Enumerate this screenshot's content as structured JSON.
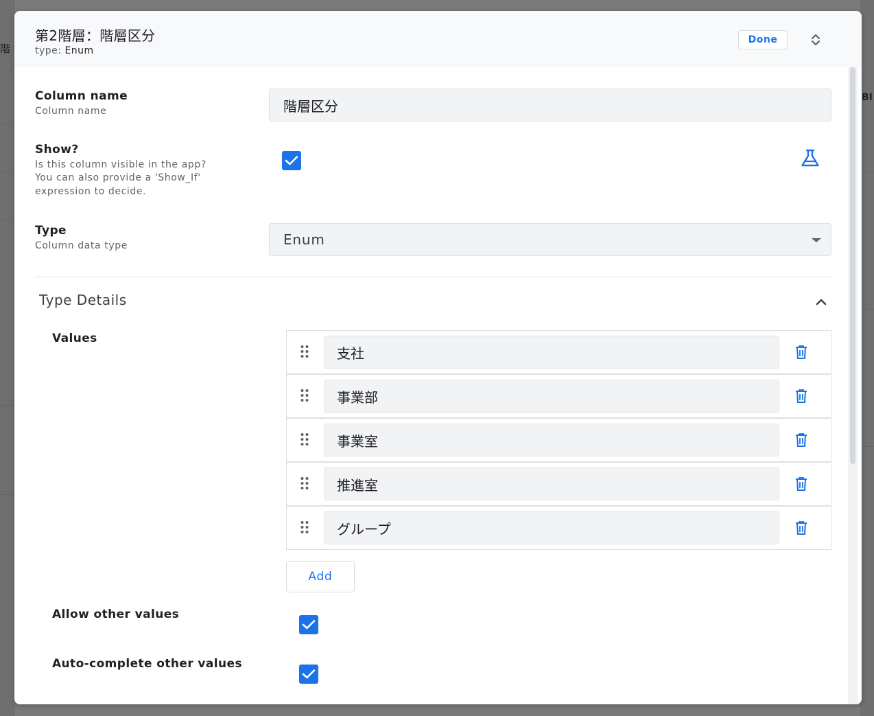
{
  "background": {
    "left_glyph": "階",
    "right_glyph": "BI"
  },
  "dialog": {
    "title": "第2階層：階層区分",
    "subtitle_label": "type: ",
    "subtitle_value": "Enum",
    "done_label": "Done",
    "expand_icon": "unfold-icon"
  },
  "column_name": {
    "title": "Column name",
    "description": "Column name",
    "value": "階層区分"
  },
  "show": {
    "title": "Show?",
    "description_lines": [
      "Is this column visible in the app?",
      "You can also provide a 'Show_If'",
      "expression to decide."
    ],
    "checked": true,
    "expression_icon": "flask-icon"
  },
  "type": {
    "title": "Type",
    "description": "Column data type",
    "value": "Enum"
  },
  "type_details": {
    "title": "Type Details",
    "values_label": "Values",
    "values": [
      "支社",
      "事業部",
      "事業室",
      "推進室",
      "グループ"
    ],
    "add_label": "Add",
    "allow_other": {
      "label": "Allow other values",
      "checked": true
    },
    "auto_complete": {
      "label": "Auto-complete other values",
      "checked": true
    }
  },
  "colors": {
    "accent": "#1a73e8",
    "field_bg": "#f1f3f4",
    "overlay": "#7a7a7a"
  }
}
